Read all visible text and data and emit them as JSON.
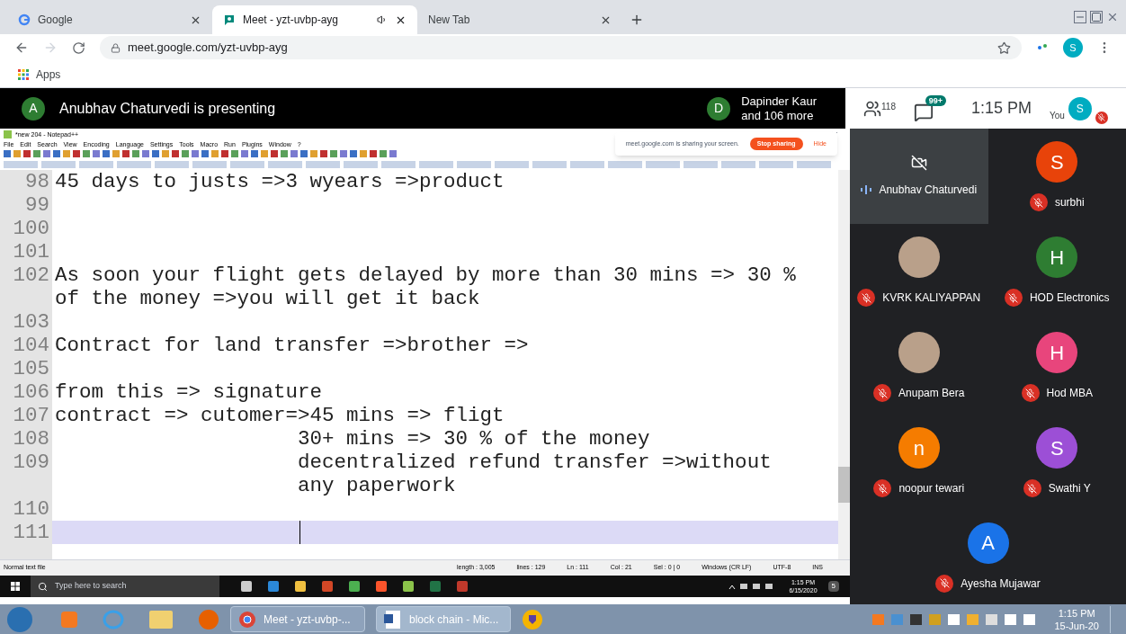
{
  "browser": {
    "tabs": [
      {
        "title": "Google",
        "selected": false,
        "kind": "google",
        "audio": false
      },
      {
        "title": "Meet - yzt-uvbp-ayg",
        "selected": true,
        "kind": "meet",
        "audio": true
      },
      {
        "title": "New Tab",
        "selected": false,
        "kind": "blank",
        "audio": false
      }
    ],
    "address": "meet.google.com/yzt-uvbp-ayg",
    "bookmark": "Apps",
    "profile": "S"
  },
  "meet_header": {
    "presenter_initial": "A",
    "presenter_text": "Anubhav Chaturvedi is presenting",
    "viewer_initial": "D",
    "viewer_name": "Dapinder Kaur",
    "viewer_more": "and 106 more",
    "people_count": "118",
    "chat_badge": "99+",
    "time": "1:15 PM",
    "you_label": "You",
    "you_initial": "S"
  },
  "notepad": {
    "title": "*new 204 - Notepad++",
    "menu": [
      "File",
      "Edit",
      "Search",
      "View",
      "Encoding",
      "Language",
      "Settings",
      "Tools",
      "Macro",
      "Run",
      "Plugins",
      "Window",
      "?"
    ],
    "share_notice": {
      "text": "meet.google.com is sharing your screen.",
      "stop": "Stop sharing",
      "hide": "Hide"
    },
    "lines": [
      {
        "number": "98",
        "segments": [
          "45 days to justs =>3 wyears =>product"
        ],
        "current": false
      },
      {
        "number": "99",
        "current": false
      },
      {
        "number": "100",
        "current": false
      },
      {
        "number": "101",
        "current": false
      },
      {
        "number": "102",
        "segments": [
          "As soon your flight gets delayed by more than 30 mins => 30 %",
          "of the money =>you will get it back"
        ],
        "current": false
      },
      {
        "number": "103",
        "current": false
      },
      {
        "number": "104",
        "segments": [
          "Contract for land transfer =>brother =>"
        ],
        "current": false
      },
      {
        "number": "105",
        "current": false
      },
      {
        "number": "106",
        "segments": [
          "from this => signature"
        ],
        "current": false
      },
      {
        "number": "107",
        "segments": [
          "contract => cutomer=>45 mins => fligt"
        ],
        "current": false
      },
      {
        "number": "108",
        "segments": [
          "                    30+ mins => 30 % of the money"
        ],
        "current": false
      },
      {
        "number": "109",
        "segments": [
          "                    decentralized refund transfer =>without",
          "                    any paperwork"
        ],
        "current": false
      },
      {
        "number": "110",
        "current": false
      },
      {
        "number": "111",
        "current": true
      }
    ],
    "status": {
      "file_type": "Normal text file",
      "length": "length : 3,005",
      "line_count": "lines : 129",
      "ln": "Ln : 111",
      "col": "Col : 21",
      "sel": "Sel : 0 | 0",
      "eol": "Windows (CR LF)",
      "encoding": "UTF-8",
      "mode": "INS"
    }
  },
  "win10_taskbar": {
    "search_placeholder": "Type here to search",
    "time": "1:15 PM",
    "date": "6/15/2020",
    "notifications": "5"
  },
  "participants": [
    {
      "name": "Anubhav Chaturvedi",
      "kind": "camera-off",
      "muted": false,
      "speaking": true,
      "selected": true
    },
    {
      "name": "surbhi",
      "kind": "letter",
      "initial": "S",
      "color": "#e8430a",
      "muted": true,
      "speaking": false,
      "selected": false
    },
    {
      "name": "KVRK KALIYAPPAN",
      "kind": "photo",
      "muted": true,
      "speaking": false,
      "selected": false
    },
    {
      "name": "HOD Electronics",
      "kind": "letter",
      "initial": "H",
      "color": "#2e7d32",
      "muted": true,
      "speaking": false,
      "selected": false
    },
    {
      "name": "Anupam Bera",
      "kind": "photo",
      "muted": true,
      "speaking": false,
      "selected": false
    },
    {
      "name": "Hod MBA",
      "kind": "letter",
      "initial": "H",
      "color": "#e8457c",
      "muted": true,
      "speaking": false,
      "selected": false
    },
    {
      "name": "noopur tewari",
      "kind": "letter",
      "initial": "n",
      "color": "#f57c00",
      "muted": true,
      "speaking": false,
      "selected": false
    },
    {
      "name": "Swathi Y",
      "kind": "letter",
      "initial": "S",
      "color": "#9c4fd6",
      "muted": true,
      "speaking": false,
      "selected": false
    },
    {
      "name": "Ayesha Mujawar",
      "kind": "letter",
      "initial": "A",
      "color": "#1a73e8",
      "muted": true,
      "speaking": false,
      "selected": false
    }
  ],
  "win7_taskbar": {
    "buttons": [
      {
        "label": "Meet - yzt-uvbp-...",
        "kind": "chrome",
        "selected": false
      },
      {
        "label": "block chain - Mic...",
        "kind": "word",
        "selected": true
      }
    ],
    "time": "1:15 PM",
    "date": "15-Jun-20"
  }
}
